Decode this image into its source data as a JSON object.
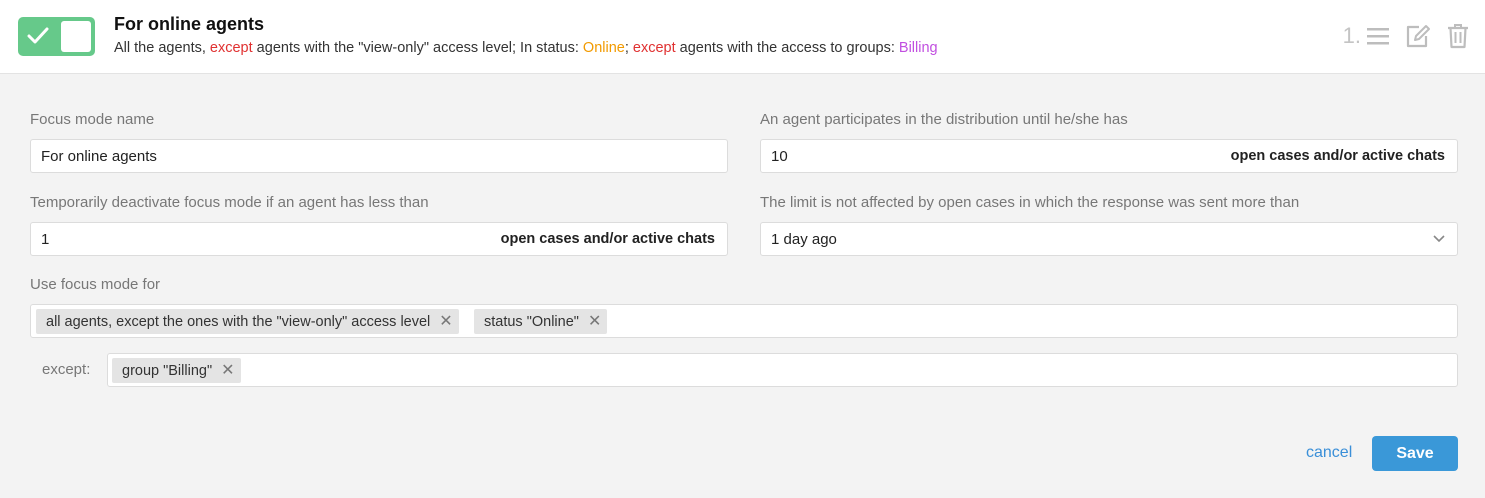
{
  "header": {
    "title": "For online agents",
    "subtitle": {
      "p1": "All the agents, ",
      "p2": "except",
      "p3": " agents with the \"view-only\" access level; In status: ",
      "p4": "Online",
      "p5": "; ",
      "p6": "except",
      "p7": " agents with the access to groups: ",
      "p8": "Billing"
    },
    "order": "1.",
    "toggle_on": true
  },
  "form": {
    "name_label": "Focus mode name",
    "name_value": "For online agents",
    "limit_label": "An agent participates in the distribution until he/she has",
    "limit_value": "10",
    "limit_suffix": "open cases and/or active chats",
    "deactivate_label": "Temporarily deactivate focus mode if an agent has less than",
    "deactivate_value": "1",
    "deactivate_suffix": "open cases and/or active chats",
    "response_label": "The limit is not affected by open cases in which the response was sent more than",
    "response_value": "1 day ago",
    "use_label": "Use focus mode for",
    "use_tags": [
      "all agents, except the ones with the \"view-only\" access level",
      "status \"Online\""
    ],
    "except_label": "except:",
    "except_tags": [
      "group \"Billing\""
    ]
  },
  "footer": {
    "cancel_label": "cancel",
    "save_label": "Save"
  },
  "colors": {
    "toggle": "#66c98a",
    "except": "#e03131",
    "online": "#f29a00",
    "group": "#c14fe0",
    "link": "#3a8fd8",
    "save": "#3a98d8"
  },
  "icons": [
    "check-icon",
    "reorder-icon",
    "edit-icon",
    "trash-icon",
    "chevron-down-icon",
    "remove-tag-icon"
  ]
}
